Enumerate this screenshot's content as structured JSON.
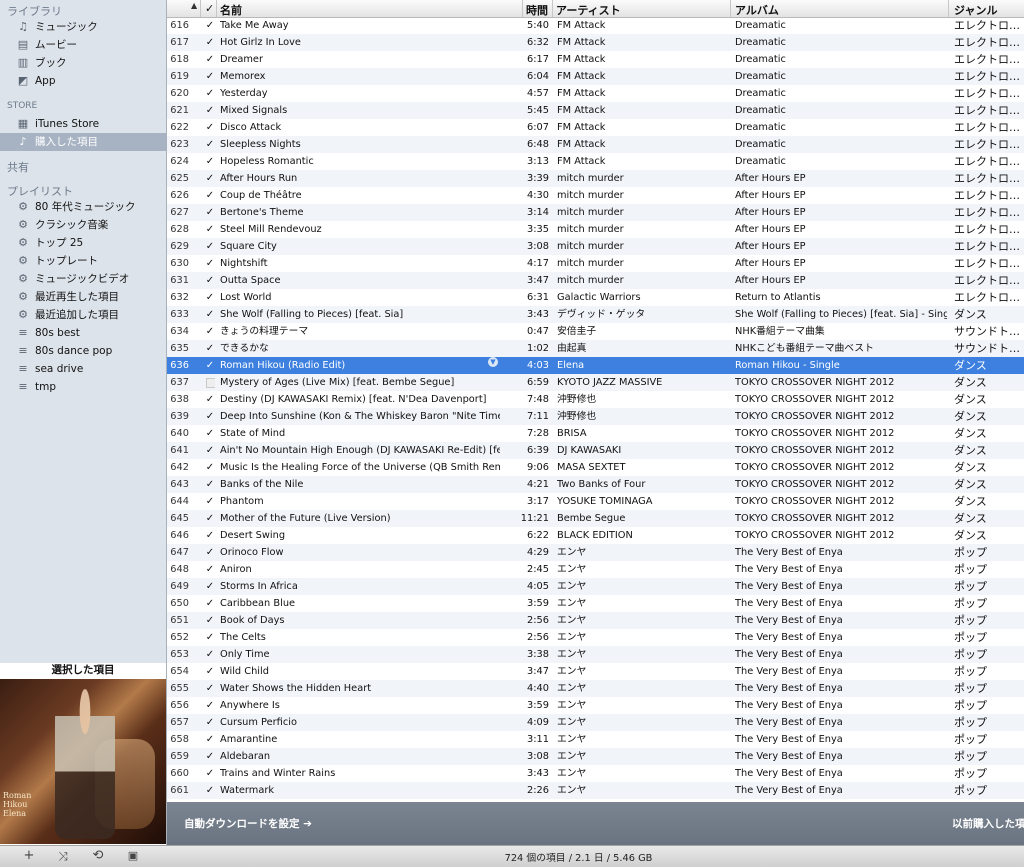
{
  "sidebar": {
    "library_header": "ライブラリ",
    "library": [
      {
        "label": "ミュージック",
        "icon": "music-note-icon"
      },
      {
        "label": "ムービー",
        "icon": "film-icon"
      },
      {
        "label": "ブック",
        "icon": "book-icon"
      },
      {
        "label": "App",
        "icon": "app-icon"
      }
    ],
    "store_header": "STORE",
    "store": [
      {
        "label": "iTunes Store",
        "icon": "store-icon"
      },
      {
        "label": "購入した項目",
        "icon": "purchased-icon",
        "selected": true
      }
    ],
    "shared_header": "共有",
    "playlists_header": "プレイリスト",
    "playlists": [
      {
        "label": "80 年代ミュージック",
        "icon": "smart-playlist-gear-icon"
      },
      {
        "label": "クラシック音楽",
        "icon": "smart-playlist-gear-icon"
      },
      {
        "label": "トップ 25",
        "icon": "smart-playlist-gear-icon"
      },
      {
        "label": "トップレート",
        "icon": "smart-playlist-gear-icon"
      },
      {
        "label": "ミュージックビデオ",
        "icon": "smart-playlist-gear-icon"
      },
      {
        "label": "最近再生した項目",
        "icon": "smart-playlist-gear-icon"
      },
      {
        "label": "最近追加した項目",
        "icon": "smart-playlist-gear-icon"
      },
      {
        "label": "80s best",
        "icon": "playlist-icon"
      },
      {
        "label": "80s dance pop",
        "icon": "playlist-icon"
      },
      {
        "label": "sea drive",
        "icon": "playlist-icon"
      },
      {
        "label": "tmp",
        "icon": "playlist-icon"
      }
    ],
    "selected_item_title": "選択した項目",
    "artwork_text": "Roman Hikou Elena"
  },
  "columns": {
    "name": "名前",
    "time": "時間",
    "artist": "アーティスト",
    "album": "アルバム",
    "genre": "ジャンル"
  },
  "tracks": [
    [
      "616",
      "Take Me Away",
      "5:40",
      "FM Attack",
      "Dreamatic",
      "エレクトロ…"
    ],
    [
      "617",
      "Hot Girlz In Love",
      "6:32",
      "FM Attack",
      "Dreamatic",
      "エレクトロ…"
    ],
    [
      "618",
      "Dreamer",
      "6:17",
      "FM Attack",
      "Dreamatic",
      "エレクトロ…"
    ],
    [
      "619",
      "Memorex",
      "6:04",
      "FM Attack",
      "Dreamatic",
      "エレクトロ…"
    ],
    [
      "620",
      "Yesterday",
      "4:57",
      "FM Attack",
      "Dreamatic",
      "エレクトロ…"
    ],
    [
      "621",
      "Mixed Signals",
      "5:45",
      "FM Attack",
      "Dreamatic",
      "エレクトロ…"
    ],
    [
      "622",
      "Disco Attack",
      "6:07",
      "FM Attack",
      "Dreamatic",
      "エレクトロ…"
    ],
    [
      "623",
      "Sleepless Nights",
      "6:48",
      "FM Attack",
      "Dreamatic",
      "エレクトロ…"
    ],
    [
      "624",
      "Hopeless Romantic",
      "3:13",
      "FM Attack",
      "Dreamatic",
      "エレクトロ…"
    ],
    [
      "625",
      "After Hours Run",
      "3:39",
      "mitch murder",
      "After Hours EP",
      "エレクトロ…"
    ],
    [
      "626",
      "Coup de Théâtre",
      "4:30",
      "mitch murder",
      "After Hours EP",
      "エレクトロ…"
    ],
    [
      "627",
      "Bertone's Theme",
      "3:14",
      "mitch murder",
      "After Hours EP",
      "エレクトロ…"
    ],
    [
      "628",
      "Steel Mill Rendevouz",
      "3:35",
      "mitch murder",
      "After Hours EP",
      "エレクトロ…"
    ],
    [
      "629",
      "Square City",
      "3:08",
      "mitch murder",
      "After Hours EP",
      "エレクトロ…"
    ],
    [
      "630",
      "Nightshift",
      "4:17",
      "mitch murder",
      "After Hours EP",
      "エレクトロ…"
    ],
    [
      "631",
      "Outta Space",
      "3:47",
      "mitch murder",
      "After Hours EP",
      "エレクトロ…"
    ],
    [
      "632",
      "Lost World",
      "6:31",
      "Galactic Warriors",
      "Return to Atlantis",
      "エレクトロ…"
    ],
    [
      "633",
      "She Wolf (Falling to Pieces) [feat. Sia]",
      "3:43",
      "デヴィッド・ゲッタ",
      "She Wolf (Falling to Pieces) [feat. Sia] - Single",
      "ダンス"
    ],
    [
      "634",
      "きょうの料理テーマ",
      "0:47",
      "安倍圭子",
      "NHK番組テーマ曲集",
      "サウンドト…"
    ],
    [
      "635",
      "できるかな",
      "1:02",
      "由起真",
      "NHKこども番組テーマ曲ベスト",
      "サウンドト…"
    ],
    [
      "636",
      "Roman Hikou (Radio Edit)",
      "4:03",
      "Elena",
      "Roman Hikou - Single",
      "ダンス"
    ],
    [
      "637",
      "Mystery of Ages (Live Mix) [feat. Bembe Segue]",
      "6:59",
      "KYOTO JAZZ MASSIVE",
      "TOKYO CROSSOVER NIGHT 2012",
      "ダンス"
    ],
    [
      "638",
      "Destiny (DJ KAWASAKI Remix) [feat. N'Dea Davenport]",
      "7:48",
      "沖野修也",
      "TOKYO CROSSOVER NIGHT 2012",
      "ダンス"
    ],
    [
      "639",
      "Deep Into Sunshine (Kon & The Whiskey Baron \"Nite Time\" …",
      "7:11",
      "沖野修也",
      "TOKYO CROSSOVER NIGHT 2012",
      "ダンス"
    ],
    [
      "640",
      "State of Mind",
      "7:28",
      "BRISA",
      "TOKYO CROSSOVER NIGHT 2012",
      "ダンス"
    ],
    [
      "641",
      "Ain't No Mountain High Enough (DJ KAWASAKI Re-Edit) [fe…",
      "6:39",
      "DJ KAWASAKI",
      "TOKYO CROSSOVER NIGHT 2012",
      "ダンス"
    ],
    [
      "642",
      "Music Is the Healing Force of the Universe (QB Smith Remix)",
      "9:06",
      "MASA SEXTET",
      "TOKYO CROSSOVER NIGHT 2012",
      "ダンス"
    ],
    [
      "643",
      "Banks of the Nile",
      "4:21",
      "Two Banks of Four",
      "TOKYO CROSSOVER NIGHT 2012",
      "ダンス"
    ],
    [
      "644",
      "Phantom",
      "3:17",
      "YOSUKE TOMINAGA",
      "TOKYO CROSSOVER NIGHT 2012",
      "ダンス"
    ],
    [
      "645",
      "Mother of the Future (Live Version)",
      "11:21",
      "Bembe Segue",
      "TOKYO CROSSOVER NIGHT 2012",
      "ダンス"
    ],
    [
      "646",
      "Desert Swing",
      "6:22",
      "BLACK EDITION",
      "TOKYO CROSSOVER NIGHT 2012",
      "ダンス"
    ],
    [
      "647",
      "Orinoco Flow",
      "4:29",
      "エンヤ",
      "The Very Best of Enya",
      "ポップ"
    ],
    [
      "648",
      "Aniron",
      "2:45",
      "エンヤ",
      "The Very Best of Enya",
      "ポップ"
    ],
    [
      "649",
      "Storms In Africa",
      "4:05",
      "エンヤ",
      "The Very Best of Enya",
      "ポップ"
    ],
    [
      "650",
      "Caribbean Blue",
      "3:59",
      "エンヤ",
      "The Very Best of Enya",
      "ポップ"
    ],
    [
      "651",
      "Book of Days",
      "2:56",
      "エンヤ",
      "The Very Best of Enya",
      "ポップ"
    ],
    [
      "652",
      "The Celts",
      "2:56",
      "エンヤ",
      "The Very Best of Enya",
      "ポップ"
    ],
    [
      "653",
      "Only Time",
      "3:38",
      "エンヤ",
      "The Very Best of Enya",
      "ポップ"
    ],
    [
      "654",
      "Wild Child",
      "3:47",
      "エンヤ",
      "The Very Best of Enya",
      "ポップ"
    ],
    [
      "655",
      "Water Shows the Hidden Heart",
      "4:40",
      "エンヤ",
      "The Very Best of Enya",
      "ポップ"
    ],
    [
      "656",
      "Anywhere Is",
      "3:59",
      "エンヤ",
      "The Very Best of Enya",
      "ポップ"
    ],
    [
      "657",
      "Cursum Perficio",
      "4:09",
      "エンヤ",
      "The Very Best of Enya",
      "ポップ"
    ],
    [
      "658",
      "Amarantine",
      "3:11",
      "エンヤ",
      "The Very Best of Enya",
      "ポップ"
    ],
    [
      "659",
      "Aldebaran",
      "3:08",
      "エンヤ",
      "The Very Best of Enya",
      "ポップ"
    ],
    [
      "660",
      "Trains and Winter Rains",
      "3:43",
      "エンヤ",
      "The Very Best of Enya",
      "ポップ"
    ],
    [
      "661",
      "Watermark",
      "2:26",
      "エンヤ",
      "The Very Best of Enya",
      "ポップ"
    ]
  ],
  "selected_track": "636",
  "unchecked_track": "637",
  "download_bar": {
    "auto_download": "自動ダウンロードを設定 ➔",
    "previously_purchased": "以前購入した項"
  },
  "status": {
    "summary": "724 個の項目 / 2.1 日 / 5.46 GB"
  },
  "colors": {
    "selection": "#3d80df",
    "sidebar_bg": "#dde3ea",
    "sidebar_selection": "#a7b3c3"
  }
}
